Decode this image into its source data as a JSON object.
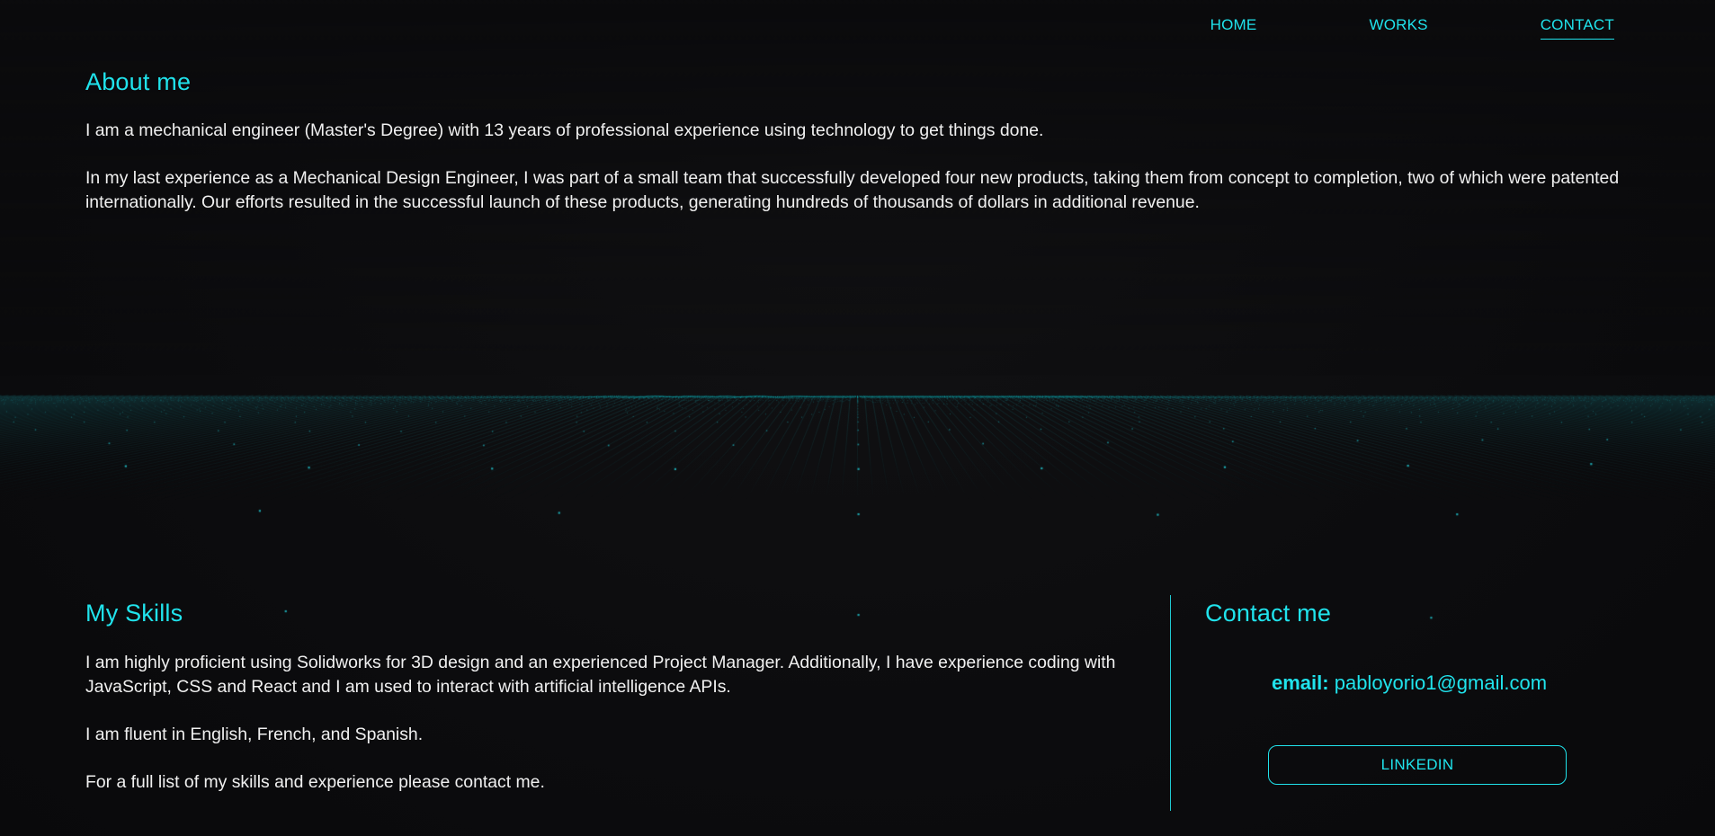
{
  "nav": {
    "items": [
      {
        "label": "HOME",
        "active": false
      },
      {
        "label": "WORKS",
        "active": false
      },
      {
        "label": "CONTACT",
        "active": true
      }
    ]
  },
  "about": {
    "title": "About me",
    "paragraphs": [
      "I am a mechanical engineer (Master's Degree) with 13 years of professional experience using technology to get things done.",
      "In my last experience as a Mechanical Design Engineer, I was part of a small team that successfully developed four new products, taking them from concept to completion, two of which were patented internationally. Our efforts resulted in the successful launch of these products, generating hundreds of thousands of dollars in additional revenue."
    ]
  },
  "skills": {
    "title": "My Skills",
    "paragraphs": [
      "I am highly proficient using Solidworks for 3D design and an experienced Project Manager. Additionally, I have experience coding with JavaScript, CSS and React and I am used to interact with artificial intelligence APIs.",
      "I am fluent in English, French, and Spanish.",
      "For a full list of my skills and experience please contact me."
    ]
  },
  "contact": {
    "title": "Contact me",
    "email_label": "email:",
    "email_value": "pabloyorio1@gmail.com",
    "linkedin_label": "LINKEDIN"
  },
  "theme": {
    "accent": "#20e3ec",
    "background": "#0b0b0d",
    "text": "#f0f0f0"
  },
  "background_graphic": "teal-dot-grid-wave"
}
